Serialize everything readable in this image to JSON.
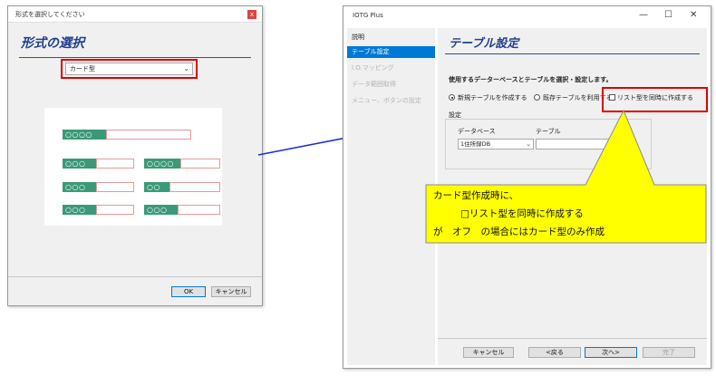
{
  "left_dialog": {
    "title": "形式を選択してください",
    "close": "x",
    "heading": "形式の選択",
    "format_select": {
      "value": "カード型"
    },
    "preview": {
      "top_tag": "○○○○",
      "tags": [
        "○○○",
        "○○○○",
        "○○○",
        "○○",
        "○○○",
        "○○○"
      ]
    },
    "buttons": {
      "ok": "OK",
      "cancel": "キャンセル"
    }
  },
  "right_window": {
    "title": "IOTG Plus",
    "window_controls": {
      "minimize": "—",
      "maximize": "☐",
      "close": "✕"
    },
    "sidebar": {
      "items": [
        {
          "label": "説明",
          "state": "normal"
        },
        {
          "label": "テーブル設定",
          "state": "active"
        },
        {
          "label": "I.O.マッピング",
          "state": "disabled"
        },
        {
          "label": "データ範囲取得",
          "state": "disabled"
        },
        {
          "label": "メニュー、ボタンの設定",
          "state": "disabled"
        }
      ]
    },
    "heading": "テーブル設定",
    "instruction": "使用するデーターベースとテーブルを選択・設定します。",
    "radio_new": "新規テーブルを作成する",
    "radio_existing": "既存テーブルを利用する",
    "checkbox_list": "リスト型を同時に作成する",
    "settings_label": "設定",
    "database_label": "データベース",
    "table_label": "テーブル",
    "database_value": "1住所録DB",
    "buttons": {
      "cancel": "キャンセル",
      "back": "<戻る",
      "next": "次へ>",
      "finish": "完了"
    }
  },
  "callout": {
    "line1": "カード型作成時に、",
    "line2": "□リスト型を同時に作成する",
    "line3": "が　オフ　の場合にはカード型のみ作成"
  },
  "colors": {
    "accent_blue": "#0078d7",
    "heading_navy": "#1f3f8f",
    "highlight_red": "#e00000",
    "tag_green": "#3a9a78",
    "callout_yellow": "#ffff00",
    "arrow_blue": "#1a2fd6"
  }
}
